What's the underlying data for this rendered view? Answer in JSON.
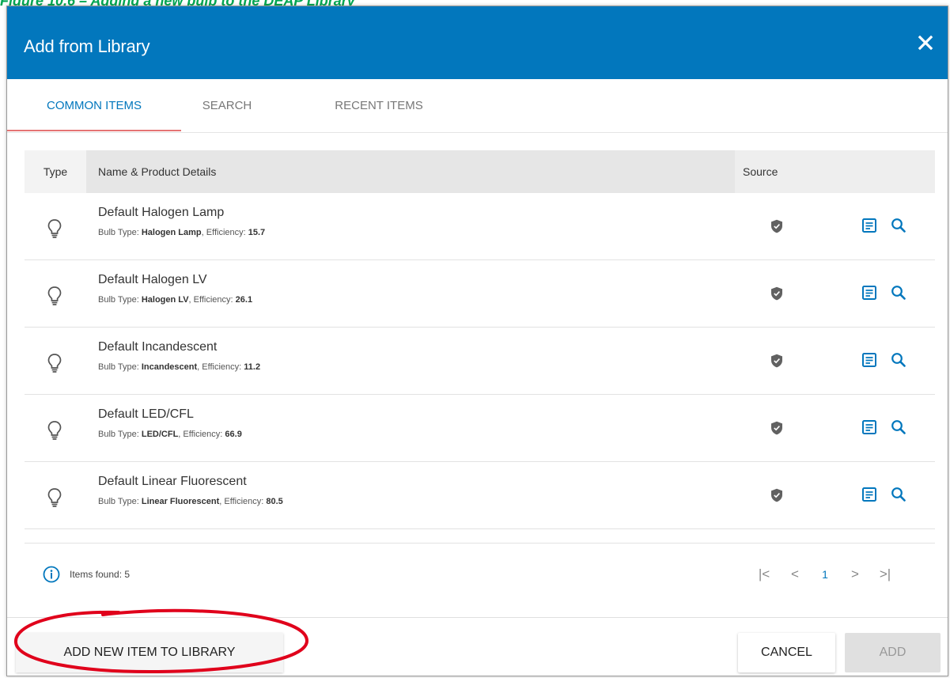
{
  "figure_caption": "Figure 10.6 – Adding a new bulb to the DEAP Library",
  "dialog": {
    "title": "Add from Library",
    "close_icon": "close-icon"
  },
  "tabs": [
    {
      "label": "COMMON ITEMS",
      "active": true
    },
    {
      "label": "SEARCH",
      "active": false
    },
    {
      "label": "RECENT ITEMS",
      "active": false
    }
  ],
  "table": {
    "headers": {
      "type": "Type",
      "name": "Name & Product Details",
      "source": "Source"
    },
    "rows": [
      {
        "name": "Default Halogen Lamp",
        "bulb_label": "Bulb Type: ",
        "bulb_type": "Halogen Lamp",
        "eff_label": ", Efficiency: ",
        "efficiency": "15.7"
      },
      {
        "name": "Default Halogen LV",
        "bulb_label": "Bulb Type: ",
        "bulb_type": "Halogen LV",
        "eff_label": ", Efficiency: ",
        "efficiency": "26.1"
      },
      {
        "name": "Default Incandescent",
        "bulb_label": "Bulb Type: ",
        "bulb_type": "Incandescent",
        "eff_label": ", Efficiency: ",
        "efficiency": "11.2"
      },
      {
        "name": "Default LED/CFL",
        "bulb_label": "Bulb Type: ",
        "bulb_type": "LED/CFL",
        "eff_label": ", Efficiency: ",
        "efficiency": "66.9"
      },
      {
        "name": "Default Linear Fluorescent",
        "bulb_label": "Bulb Type: ",
        "bulb_type": "Linear Fluorescent",
        "eff_label": ", Efficiency: ",
        "efficiency": "80.5"
      }
    ]
  },
  "footer": {
    "items_found": "Items found: 5",
    "pager": {
      "first": "|<",
      "prev": "<",
      "current_page": "1",
      "next": ">",
      "last": ">|"
    }
  },
  "actions": {
    "add_new": "ADD NEW ITEM TO LIBRARY",
    "cancel": "CANCEL",
    "add": "ADD"
  },
  "colors": {
    "header_bg": "#0277bd",
    "accent": "#0277bd",
    "highlight": "#e0001b",
    "caption": "#00a651"
  }
}
